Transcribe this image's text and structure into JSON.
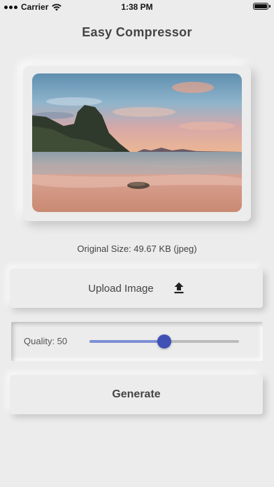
{
  "status_bar": {
    "carrier": "Carrier",
    "time": "1:38 PM",
    "icons": [
      "signal-icon",
      "wifi-icon",
      "battery-icon"
    ]
  },
  "app": {
    "title": "Easy Compressor"
  },
  "image_info": {
    "original_size": "Original Size: 49.67 KB (jpeg)"
  },
  "upload": {
    "label": "Upload Image",
    "icon": "upload-icon"
  },
  "quality": {
    "label": "Quality: 50",
    "value": 50,
    "min": 0,
    "max": 100
  },
  "generate": {
    "label": "Generate"
  },
  "colors": {
    "background": "#ececec",
    "accent": "#3f51b5",
    "slider_fill": "#7d8fd6",
    "text": "#444444"
  }
}
